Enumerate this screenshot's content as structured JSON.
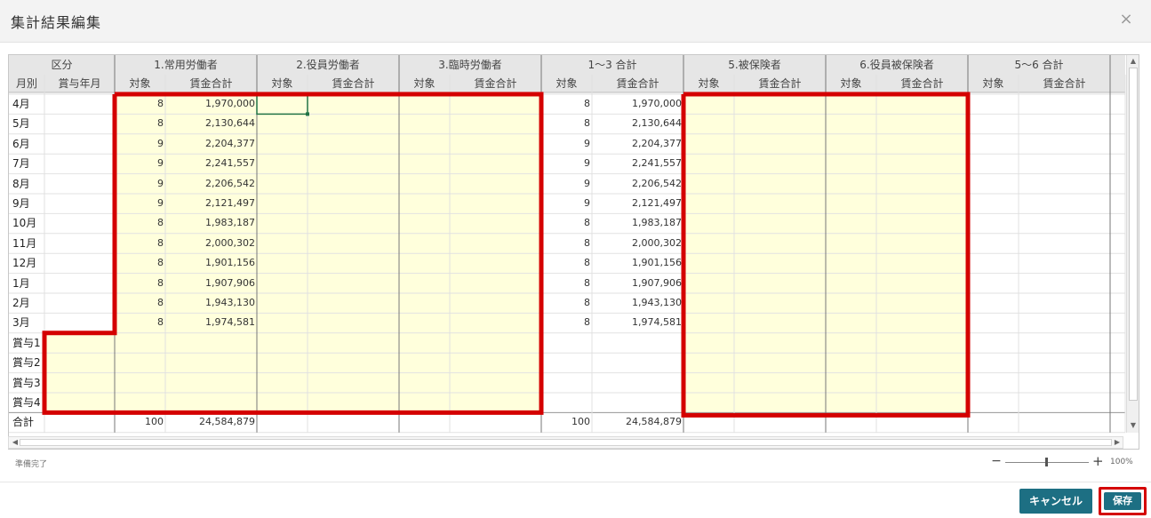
{
  "dialog": {
    "title": "集計結果編集",
    "close_icon": "×"
  },
  "headers": {
    "kubun": "区分",
    "tsukibetsu": "月別",
    "shoyo_nengetsu": "賞与年月",
    "groups": [
      "1.常用労働者",
      "2.役員労働者",
      "3.臨時労働者",
      "1～3 合計",
      "5.被保険者",
      "6.役員被保険者",
      "5～6 合計"
    ],
    "taisho": "対象",
    "chingin_gokei": "賃金合計"
  },
  "rows": [
    {
      "label": "4月",
      "c1_count": "8",
      "c1_wage": "1,970,000",
      "t_count": "8",
      "t_wage": "1,970,000"
    },
    {
      "label": "5月",
      "c1_count": "8",
      "c1_wage": "2,130,644",
      "t_count": "8",
      "t_wage": "2,130,644"
    },
    {
      "label": "6月",
      "c1_count": "9",
      "c1_wage": "2,204,377",
      "t_count": "9",
      "t_wage": "2,204,377"
    },
    {
      "label": "7月",
      "c1_count": "9",
      "c1_wage": "2,241,557",
      "t_count": "9",
      "t_wage": "2,241,557"
    },
    {
      "label": "8月",
      "c1_count": "9",
      "c1_wage": "2,206,542",
      "t_count": "9",
      "t_wage": "2,206,542"
    },
    {
      "label": "9月",
      "c1_count": "9",
      "c1_wage": "2,121,497",
      "t_count": "9",
      "t_wage": "2,121,497"
    },
    {
      "label": "10月",
      "c1_count": "8",
      "c1_wage": "1,983,187",
      "t_count": "8",
      "t_wage": "1,983,187"
    },
    {
      "label": "11月",
      "c1_count": "8",
      "c1_wage": "2,000,302",
      "t_count": "8",
      "t_wage": "2,000,302"
    },
    {
      "label": "12月",
      "c1_count": "8",
      "c1_wage": "1,901,156",
      "t_count": "8",
      "t_wage": "1,901,156"
    },
    {
      "label": "1月",
      "c1_count": "8",
      "c1_wage": "1,907,906",
      "t_count": "8",
      "t_wage": "1,907,906"
    },
    {
      "label": "2月",
      "c1_count": "8",
      "c1_wage": "1,943,130",
      "t_count": "8",
      "t_wage": "1,943,130"
    },
    {
      "label": "3月",
      "c1_count": "8",
      "c1_wage": "1,974,581",
      "t_count": "8",
      "t_wage": "1,974,581"
    },
    {
      "label": "賞与1"
    },
    {
      "label": "賞与2"
    },
    {
      "label": "賞与3"
    },
    {
      "label": "賞与4"
    },
    {
      "label": "合計",
      "c1_count": "100",
      "c1_wage": "24,584,879",
      "t_count": "100",
      "t_wage": "24,584,879"
    }
  ],
  "status": {
    "text": "準備完了",
    "zoom": "100%",
    "zoom_minus": "−",
    "zoom_plus": "+"
  },
  "buttons": {
    "cancel": "キャンセル",
    "save": "保存"
  },
  "colors": {
    "editable_fill": "#ffffdc",
    "highlight_border": "#d40000",
    "button": "#1d6f83"
  }
}
